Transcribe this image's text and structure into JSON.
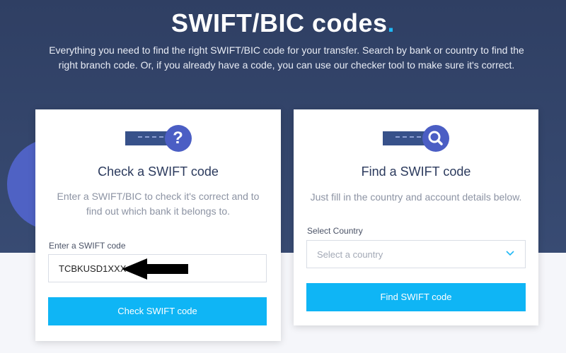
{
  "hero": {
    "title": "SWIFT/BIC codes",
    "title_dot": ".",
    "subtitle": "Everything you need to find the right SWIFT/BIC code for your transfer. Search by bank or country to find the right branch code. Or, if you already have a code, you can use our checker tool to make sure it's correct."
  },
  "check_card": {
    "icon": "card-question-icon",
    "badge_glyph": "?",
    "title": "Check a SWIFT code",
    "description": "Enter a SWIFT/BIC to check it's correct and to find out which bank it belongs to.",
    "input_label": "Enter a SWIFT code",
    "input_value": "TCBKUSD1XXX",
    "button_label": "Check SWIFT code"
  },
  "find_card": {
    "icon": "card-search-icon",
    "title": "Find a SWIFT code",
    "description": "Just fill in the country and account details below.",
    "select_label": "Select Country",
    "select_placeholder": "Select a country",
    "button_label": "Find SWIFT code"
  },
  "colors": {
    "hero_bg": "#2f3f63",
    "accent": "#0fb5f5",
    "icon_badge": "#4b5ec4",
    "title_text": "#2b3a5d"
  }
}
